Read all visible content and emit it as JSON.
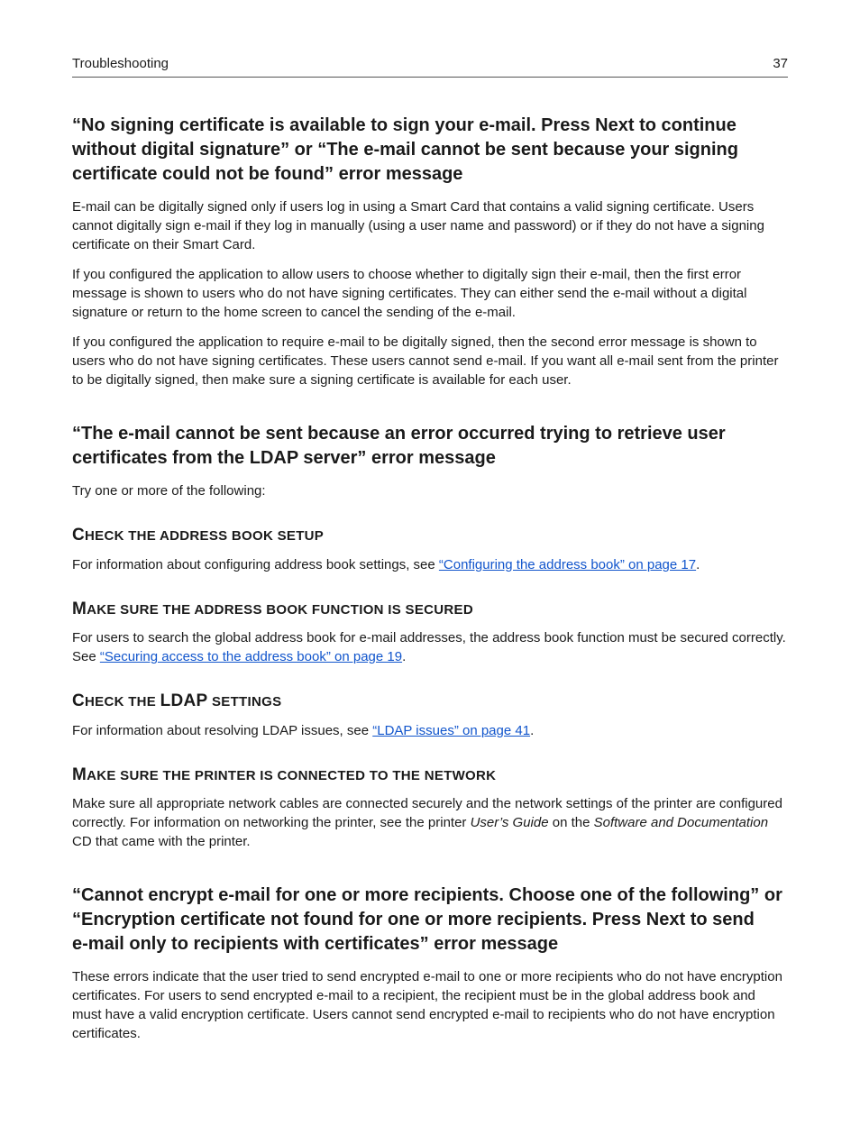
{
  "header": {
    "section": "Troubleshooting",
    "page_number": "37"
  },
  "s1": {
    "heading": "“No signing certificate is available to sign your e‑mail. Press Next to continue without digital signature” or “The e‑mail cannot be sent because your signing certificate could not be found” error message",
    "p1": "E‑mail can be digitally signed only if users log in using a Smart Card that contains a valid signing certificate. Users cannot digitally sign e‑mail if they log in manually (using a user name and password) or if they do not have a signing certificate on their Smart Card.",
    "p2": "If you configured the application to allow users to choose whether to digitally sign their e‑mail, then the first error message is shown to users who do not have signing certificates. They can either send the e‑mail without a digital signature or return to the home screen to cancel the sending of the e‑mail.",
    "p3": "If you configured the application to require e‑mail to be digitally signed, then the second error message is shown to users who do not have signing certificates. These users cannot send e‑mail. If you want all e‑mail sent from the printer to be digitally signed, then make sure a signing certificate is available for each user."
  },
  "s2": {
    "heading": "“The e‑mail cannot be sent because an error occurred trying to retrieve user certificates from the LDAP server” error message",
    "intro": "Try one or more of the following:",
    "sub1": {
      "p_before": "For information about configuring address book settings, see ",
      "link": "“Configuring the address book” on page 17",
      "p_after": "."
    },
    "sub2": {
      "p_before": "For users to search the global address book for e‑mail addresses, the address book function must be secured correctly. See ",
      "link": "“Securing access to the address book” on page 19",
      "p_after": "."
    },
    "sub3": {
      "p_before": "For information about resolving LDAP issues, see ",
      "link": "“LDAP issues” on page 41",
      "p_after": "."
    },
    "sub4": {
      "p1a": "Make sure all appropriate network cables are connected securely and the network settings of the printer are configured correctly. For information on networking the printer, see the printer ",
      "p1_italic1": "User’s Guide",
      "p1b": " on the ",
      "p1_italic2": "Software and Documentation",
      "p1c": " CD that came with the printer."
    }
  },
  "s3": {
    "heading": "“Cannot encrypt e‑mail for one or more recipients. Choose one of the following” or “Encryption certificate not found for one or more recipients. Press Next to send e‑mail only to recipients with certificates” error message",
    "p1": "These errors indicate that the user tried to send encrypted e‑mail to one or more recipients who do not have encryption certificates. For users to send encrypted e‑mail to a recipient, the recipient must be in the global address book and must have a valid encryption certificate. Users cannot send encrypted e‑mail to recipients who do not have encryption certificates."
  }
}
